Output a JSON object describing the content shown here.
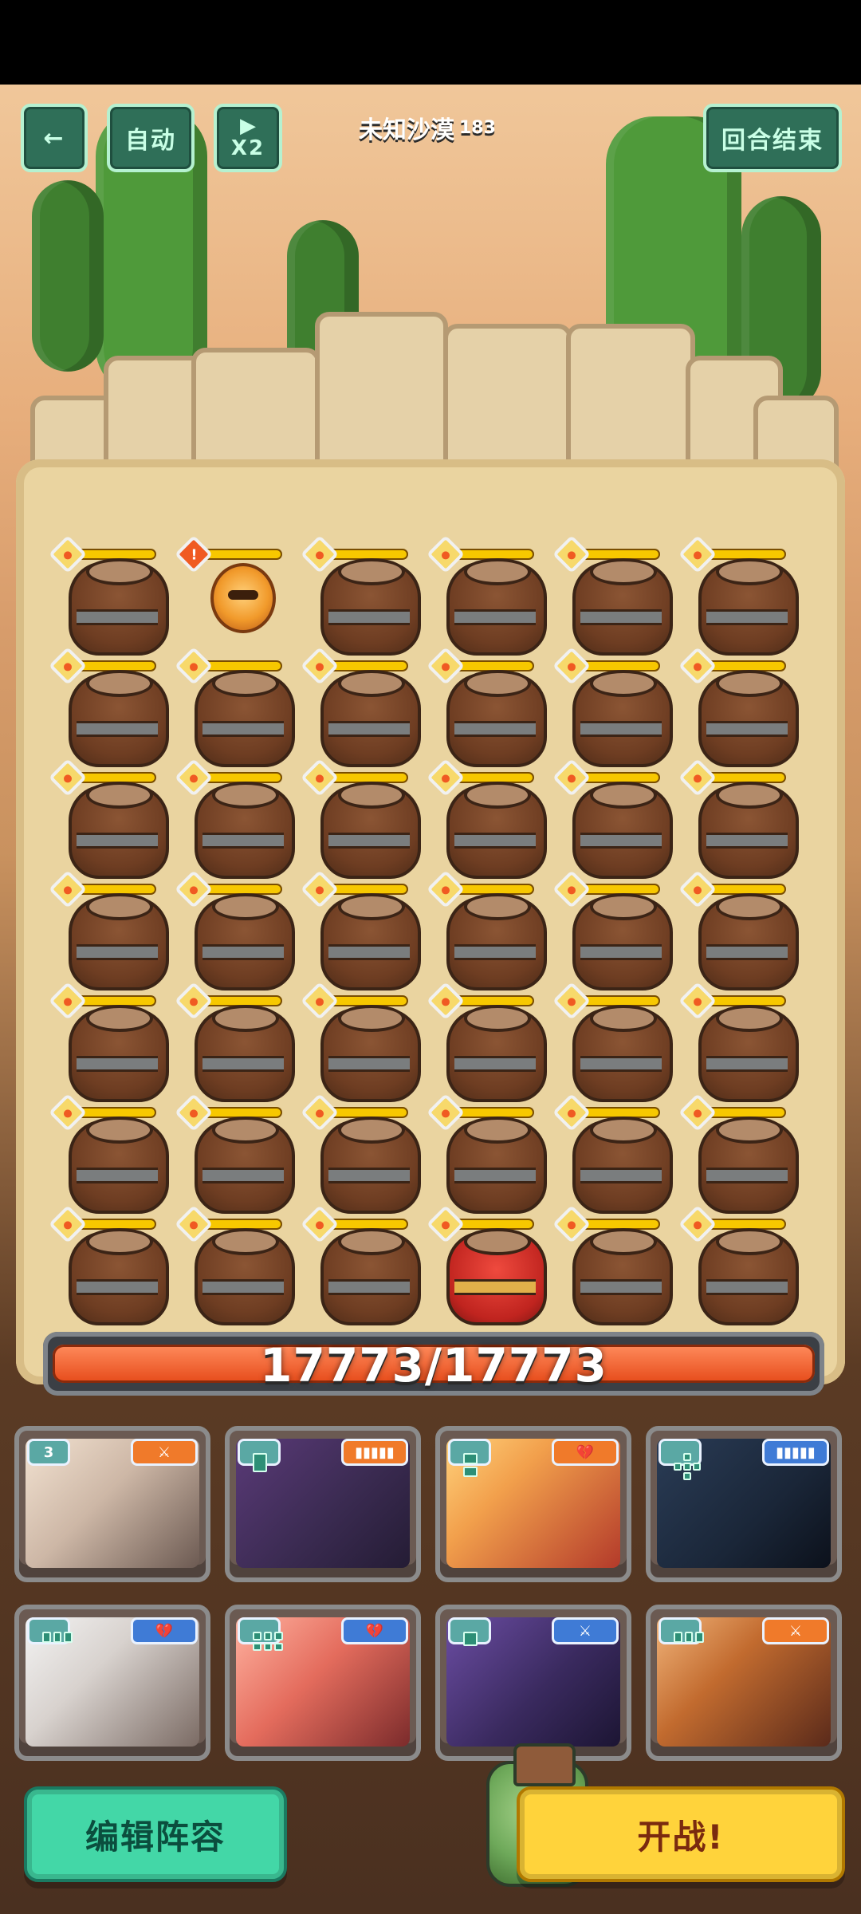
{
  "header": {
    "back_label": "←",
    "auto_label": "自动",
    "speed_label": "X2",
    "stage_name": "未知沙漠",
    "stage_number": "183",
    "end_turn_label": "回合结束"
  },
  "board": {
    "rows": 7,
    "cols": 6,
    "special": {
      "enemy": {
        "row": 0,
        "col": 1,
        "name": "fire-imp"
      },
      "red_pot": {
        "row": 6,
        "col": 3
      }
    }
  },
  "health": {
    "current": 17773,
    "max": 17773,
    "text": "17773/17773"
  },
  "team": {
    "row1": [
      {
        "badge_left": "3",
        "badge_right_icon": "sword-icon",
        "badge_right_color": "#f07a2a"
      },
      {
        "badge_left": "",
        "badge_right_icon": "bars-icon",
        "badge_right_color": "#f07a2a"
      },
      {
        "badge_left": "",
        "badge_right_icon": "heart-broken-icon",
        "badge_right_color": "#f07a2a"
      },
      {
        "badge_left": "",
        "badge_right_icon": "bars-icon",
        "badge_right_color": "#3f7bd6"
      }
    ],
    "row2": [
      {
        "badge_left": "",
        "badge_right_icon": "heart-broken-icon",
        "badge_right_color": "#3f7bd6"
      },
      {
        "badge_left": "",
        "badge_right_icon": "heart-broken-icon",
        "badge_right_color": "#3f7bd6"
      },
      {
        "badge_left": "",
        "badge_right_icon": "sword-icon",
        "badge_right_color": "#3f7bd6"
      },
      {
        "badge_left": "",
        "badge_right_icon": "sword-icon",
        "badge_right_color": "#f07a2a"
      }
    ]
  },
  "footer": {
    "edit_team_label": "编辑阵容",
    "start_battle_label": "开战!"
  }
}
